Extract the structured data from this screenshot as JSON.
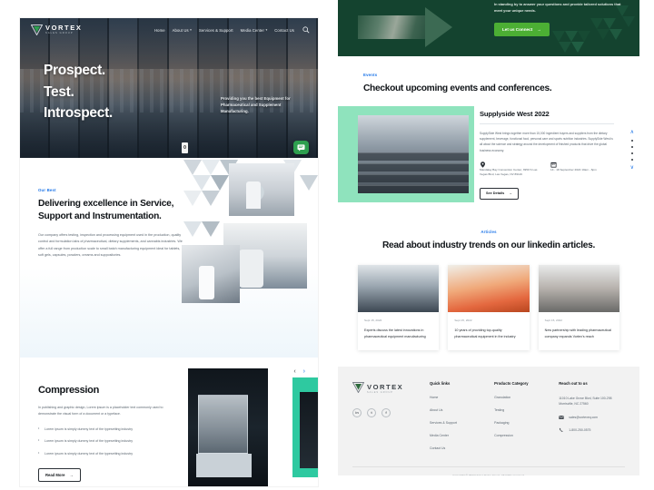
{
  "brand": {
    "name": "VORTEX",
    "tagline": "SALES GROUP"
  },
  "nav": {
    "items": [
      {
        "label": "Home",
        "caret": ""
      },
      {
        "label": "About Us",
        "caret": "▾"
      },
      {
        "label": "Services & Support",
        "caret": ""
      },
      {
        "label": "Media Center",
        "caret": "▾"
      },
      {
        "label": "Contact Us",
        "caret": ""
      }
    ],
    "search_icon": "search-icon"
  },
  "hero": {
    "line1": "Prospect.",
    "line2": "Test.",
    "line3": "Introspect.",
    "tagline": "Providing you the best Equipment for Pharmaceutical and Supplement Manufacturing.",
    "slide_indicator": "0",
    "chat_icon": "chat-bubble-icon"
  },
  "excellence": {
    "eyebrow": "Our Best",
    "heading": "Delivering excellence in Service, Support and Instrumentation.",
    "body": "Our company offers testing, inspection and processing equipment used in the production, quality control and formulation labs of pharmaceutical, dietary supplements, and cannabis industries. We offer a full range from production scale to small batch manufacturing equipment ideal for tablets, soft gels, capsules, powders, creams and suppositories."
  },
  "compression": {
    "heading": "Compression",
    "body": "In publishing and graphic design, Lorem ipsum is a placeholder text commonly used to demonstrate the visual form of a document or a typeface.",
    "bullets": [
      "Lorem ipsum is simply dummy text of the typesetting industry",
      "Lorem ipsum is simply dummy text of the typesetting industry",
      "Lorem ipsum is simply dummy text of the typesetting industry"
    ],
    "button": "Read More",
    "button_arrow": "→",
    "prev_arrow": "‹",
    "next_arrow": "›"
  },
  "cta": {
    "text": "In standing by to answer your questions and provide tailored solutions that meet your unique needs.",
    "button": "Let us Connect",
    "button_arrow": "→"
  },
  "events": {
    "eyebrow": "Events",
    "heading": "Checkout upcoming events and conferences.",
    "event": {
      "title": "Supplyside West 2022",
      "description": "SupplySide West brings together more than 15,000 ingredient buyers and suppliers from the dietary supplement, beverage, functional food, personal care and sports nutrition industries. SupplySide West is all about the science and strategy around the development of finished products that drive the global business economy.",
      "location_icon": "map-pin-icon",
      "location": "Mandalay Bay Convention Center, 3950 S Las Vegas Blvd, Las Vegas, NV 89119",
      "date_icon": "calendar-icon",
      "date": "14 - 18 September 2022 10am - 6pm",
      "button": "See Details",
      "button_arrow": "→"
    },
    "nav_up": "∧",
    "nav_down": "∨"
  },
  "articles": {
    "eyebrow": "Articles",
    "heading": "Read about industry trends on our linkedin articles.",
    "cards": [
      {
        "date": "Sept 15, 2022",
        "title": "Experts discuss the latest innovations in pharmaceutical equipment manufacturing"
      },
      {
        "date": "Sept 15, 2022",
        "title": "10 years of providing top-quality pharmaceutical equipment in the industry"
      },
      {
        "date": "Sept 15, 2022",
        "title": "New partnership with leading pharmaceutical company expands Vortex's reach"
      }
    ]
  },
  "footer": {
    "brand": "VORTEX",
    "brand_sub": "SALES GROUP",
    "socials": [
      {
        "name": "linkedin-icon",
        "glyph": "in"
      },
      {
        "name": "twitter-icon",
        "glyph": "t"
      },
      {
        "name": "facebook-icon",
        "glyph": "f"
      }
    ],
    "quick_links": {
      "title": "Quick links",
      "items": [
        "Home",
        "About Us",
        "Services & Support",
        "Media Center",
        "Contact Us"
      ]
    },
    "products": {
      "title": "Products Category",
      "items": [
        "Granulation",
        "Testing",
        "Packaging",
        "Compression"
      ]
    },
    "contact": {
      "title": "Reach out to us",
      "address": "11010 Lake Grove Blvd, Suite 100-298 Morrisville, NC 27560",
      "email_icon": "mail-icon",
      "email": "sales@vortexeq.com",
      "phone_icon": "phone-icon",
      "phone": "1-800-250-0575"
    },
    "copyright": "Copyright © 2022 Vortex Sales Group. All rights reserved."
  },
  "colors": {
    "accent_blue": "#1a73e8",
    "dark_green": "#14432f",
    "green_button": "#4caf34",
    "mint": "#8fe3bd",
    "teal": "#2ec9a0"
  }
}
